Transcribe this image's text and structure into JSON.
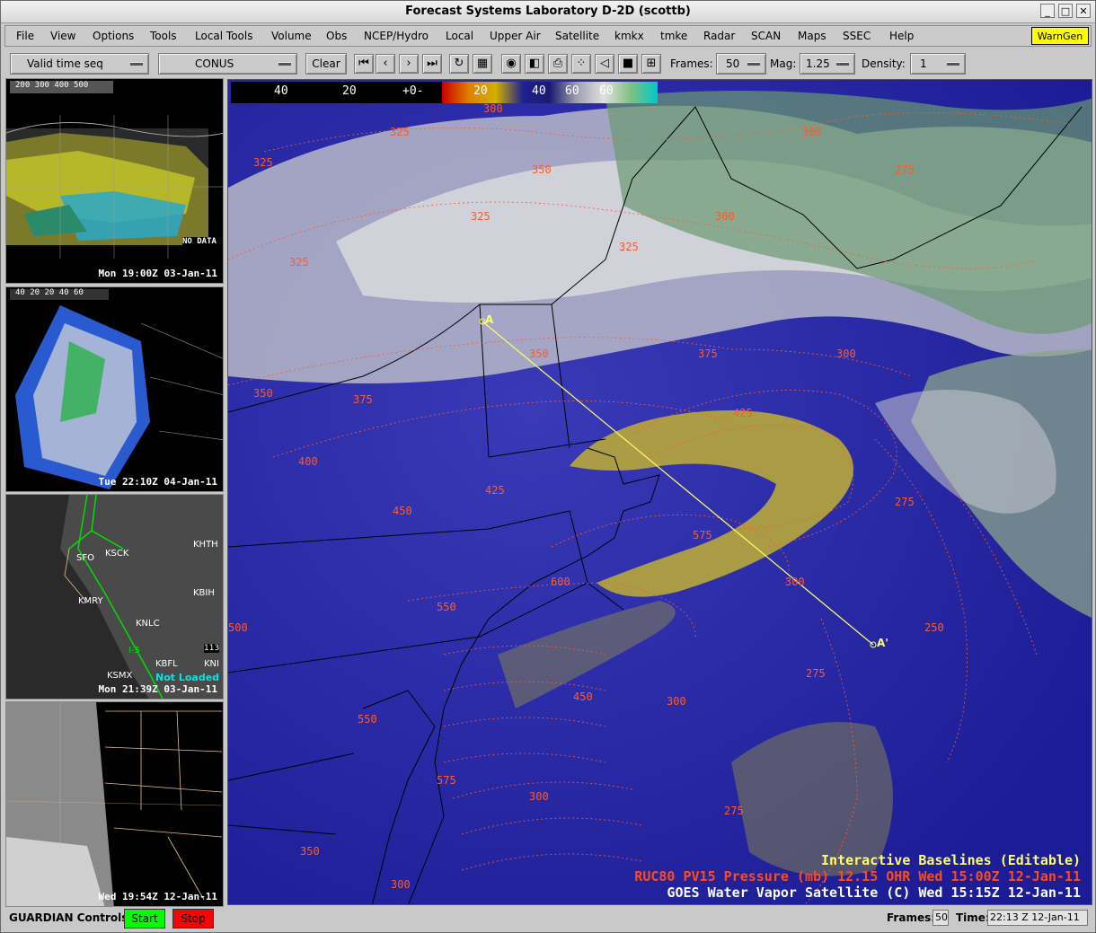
{
  "window": {
    "title": "Forecast Systems Laboratory D-2D (scottb)"
  },
  "menubar": {
    "items": [
      "File",
      "View",
      "Options",
      "Tools",
      "Local Tools",
      "Volume",
      "Obs",
      "NCEP/Hydro",
      "Local",
      "Upper Air",
      "Satellite",
      "kmkx",
      "tmke",
      "Radar",
      "SCAN",
      "Maps",
      "SSEC",
      "Help"
    ],
    "warngen_label": "WarnGen"
  },
  "toolbar": {
    "time_mode": "Valid time seq",
    "scale": "CONUS",
    "clear_label": "Clear",
    "frames_label": "Frames:",
    "frames_value": "50",
    "mag_label": "Mag:",
    "mag_value": "1.25",
    "density_label": "Density:",
    "density_value": "1"
  },
  "panels": [
    {
      "legend": "200 300 400 500",
      "badge": "NO DATA",
      "time": "Mon 19:00Z 03-Jan-11"
    },
    {
      "legend": "40 20   20 40 60",
      "time": "Tue 22:10Z 04-Jan-11"
    },
    {
      "labels": [
        "KHTH",
        "KSCK",
        "SFO",
        "KBIH",
        "KMRY",
        "KNLC",
        "I-5",
        "KBFL",
        "KNI",
        "KSMX",
        "113"
      ],
      "badge": "Not Loaded",
      "time": "Mon 21:39Z 03-Jan-11"
    },
    {
      "time": "Wed 19:54Z 12-Jan-11"
    }
  ],
  "colorbar": {
    "labels": [
      "40",
      "20",
      "+0-",
      "20",
      "40",
      "60",
      "60"
    ]
  },
  "map": {
    "contour_labels": [
      "300",
      "325",
      "325",
      "300",
      "275",
      "325",
      "350",
      "325",
      "300",
      "325",
      "350",
      "375",
      "300",
      "350",
      "375",
      "425",
      "400",
      "425",
      "450",
      "575",
      "275",
      "600",
      "550",
      "300",
      "500",
      "250",
      "450",
      "275",
      "300",
      "550",
      "575",
      "300",
      "275",
      "350",
      "300"
    ],
    "baseline_labels": [
      "A",
      "A'"
    ],
    "overlays": {
      "line1": "Interactive Baselines (Editable)",
      "line2": "RUC80 PV15 Pressure (mb)  12.15   OHR Wed 15:00Z 12-Jan-11",
      "line3": "GOES Water Vapor Satellite (C)  Wed 15:15Z 12-Jan-11"
    }
  },
  "status": {
    "guardian_label": "GUARDIAN Controls:",
    "start_label": "Start",
    "stop_label": "Stop",
    "frames_label": "Frames:",
    "frames_value": "50",
    "time_label": "Time:",
    "time_value": "22:13 Z 12-Jan-11"
  },
  "colors": {
    "accent_yellow": "#ffff00",
    "start_green": "#00ff00",
    "stop_red": "#ff0000",
    "contour_orange": "#ff5a2a"
  }
}
